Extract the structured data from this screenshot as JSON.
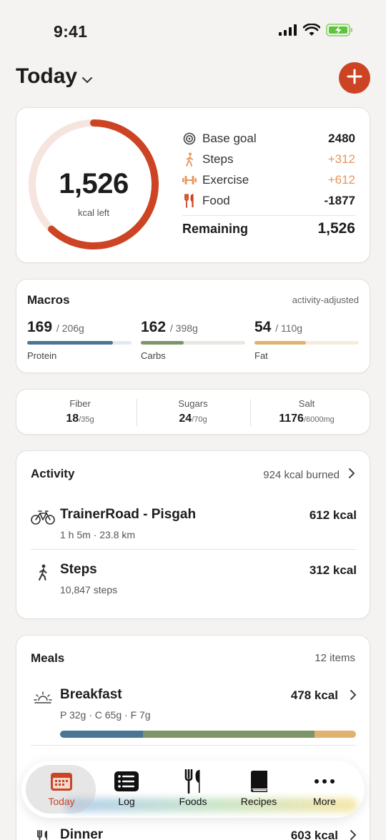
{
  "status": {
    "time": "9:41"
  },
  "header": {
    "title": "Today"
  },
  "calories": {
    "left_value": "1,526",
    "left_unit": "kcal left",
    "progress_fraction": 0.62,
    "rows": [
      {
        "label": "Base goal",
        "value": "2480",
        "icon": "target-icon",
        "color": "#1c1c1c"
      },
      {
        "label": "Steps",
        "value": "+312",
        "icon": "walking-icon",
        "color": "#e8955e"
      },
      {
        "label": "Exercise",
        "value": "+612",
        "icon": "dumbbell-icon",
        "color": "#e8955e"
      },
      {
        "label": "Food",
        "value": "-1877",
        "icon": "fork-knife-icon",
        "color": "#1c1c1c"
      }
    ],
    "remaining_label": "Remaining",
    "remaining_value": "1,526"
  },
  "macros": {
    "title": "Macros",
    "note": "activity-adjusted",
    "items": [
      {
        "value": "169",
        "total": "/ 206g",
        "name": "Protein",
        "fraction": 0.82,
        "color": "#4a7595",
        "track": "#e2eaf0"
      },
      {
        "value": "162",
        "total": "/ 398g",
        "name": "Carbs",
        "fraction": 0.41,
        "color": "#7d9468",
        "track": "#e6e8e2"
      },
      {
        "value": "54",
        "total": "/ 110g",
        "name": "Fat",
        "fraction": 0.49,
        "color": "#e1b26d",
        "track": "#f6ecdd"
      }
    ]
  },
  "micros": [
    {
      "name": "Fiber",
      "value": "18",
      "total": "/35g"
    },
    {
      "name": "Sugars",
      "value": "24",
      "total": "/70g"
    },
    {
      "name": "Salt",
      "value": "1176",
      "total": "/6000mg"
    }
  ],
  "activity": {
    "title": "Activity",
    "summary": "924 kcal burned",
    "items": [
      {
        "name": "TrainerRoad - Pisgah",
        "sub": "1 h 5m · 23.8 km",
        "kcal": "612 kcal",
        "icon": "bicycle-icon"
      },
      {
        "name": "Steps",
        "sub": "10,847 steps",
        "kcal": "312 kcal",
        "icon": "walking-icon"
      }
    ]
  },
  "meals": {
    "title": "Meals",
    "count": "12 items",
    "items": [
      {
        "name": "Breakfast",
        "sub": "P 32g · C 65g · F 7g",
        "kcal": "478 kcal",
        "icon": "sunrise-icon",
        "split": [
          {
            "fraction": 0.28,
            "color": "#4a7595"
          },
          {
            "fraction": 0.58,
            "color": "#7d9468"
          },
          {
            "fraction": 0.14,
            "color": "#e1b26d"
          }
        ]
      },
      {
        "name": "Dinner",
        "kcal": "603 kcal",
        "icon": "fork-knife-icon"
      }
    ]
  },
  "nav": [
    {
      "label": "Today",
      "icon": "calendar-icon",
      "active": true,
      "color": "#cc4424"
    },
    {
      "label": "Log",
      "icon": "list-icon",
      "active": false
    },
    {
      "label": "Foods",
      "icon": "fork-knife-icon",
      "active": false
    },
    {
      "label": "Recipes",
      "icon": "book-icon",
      "active": false
    },
    {
      "label": "More",
      "icon": "more-icon",
      "active": false
    }
  ]
}
